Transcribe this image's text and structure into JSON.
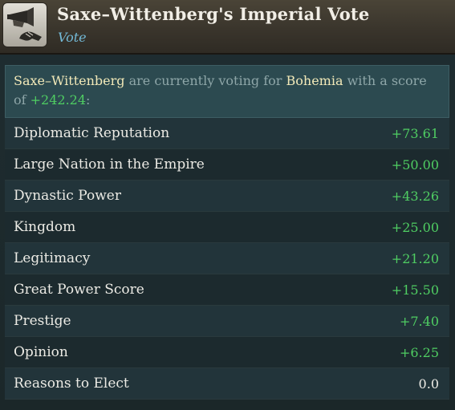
{
  "header": {
    "title": "Saxe–Wittenberg's Imperial Vote",
    "subtitle": "Vote",
    "icon": "herald-trumpet-handshake-icon"
  },
  "summary": {
    "voter": "Saxe–Wittenberg",
    "text1": " are currently voting for ",
    "candidate": "Bohemia",
    "text2": " with a score of ",
    "score": "+242.24",
    "text3": ":"
  },
  "colors": {
    "positive": "#4fcd62",
    "highlight": "#f2e9b8",
    "subtitle": "#73b9d6"
  },
  "rows": [
    {
      "label": "Diplomatic Reputation",
      "value": "+73.61"
    },
    {
      "label": "Large Nation in the Empire",
      "value": "+50.00"
    },
    {
      "label": "Dynastic Power",
      "value": "+43.26"
    },
    {
      "label": "Kingdom",
      "value": "+25.00"
    },
    {
      "label": "Legitimacy",
      "value": "+21.20"
    },
    {
      "label": "Great Power Score",
      "value": "+15.50"
    },
    {
      "label": "Prestige",
      "value": "+7.40"
    },
    {
      "label": "Opinion",
      "value": "+6.25"
    },
    {
      "label": "Reasons to Elect",
      "value": "0.0"
    }
  ]
}
